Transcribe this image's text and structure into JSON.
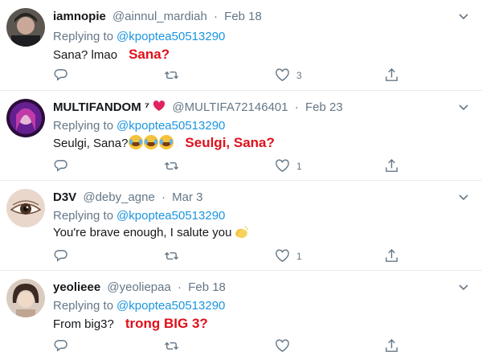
{
  "tweets": [
    {
      "name": "iamnopie",
      "handle": "@ainnul_mardiah",
      "dot": "·",
      "date": "Feb 18",
      "replying_label": "Replying to",
      "replying_handle": "@kpoptea50513290",
      "text": "Sana? lmao",
      "annotation": "Sana?",
      "likes": "3"
    },
    {
      "name": "MULTIFANDOM",
      "name_suffix": "⁷",
      "handle": "@MULTIFA72146401",
      "dot": "·",
      "date": "Feb 23",
      "replying_label": "Replying to",
      "replying_handle": "@kpoptea50513290",
      "text": "Seulgi, Sana?",
      "annotation": "Seulgi, Sana?",
      "likes": "1"
    },
    {
      "name": "D3V",
      "handle": "@deby_agne",
      "dot": "·",
      "date": "Mar 3",
      "replying_label": "Replying to",
      "replying_handle": "@kpoptea50513290",
      "text": "You're brave enough, I salute you",
      "likes": "1"
    },
    {
      "name": "yeolieee",
      "handle": "@yeoliepaa",
      "dot": "·",
      "date": "Feb 18",
      "replying_label": "Replying to",
      "replying_handle": "@kpoptea50513290",
      "text": "From big3?",
      "annotation": "trong BIG 3?",
      "likes": ""
    }
  ],
  "colors": {
    "link": "#1b95e0",
    "annotation": "#e0101a",
    "muted": "#657786"
  }
}
